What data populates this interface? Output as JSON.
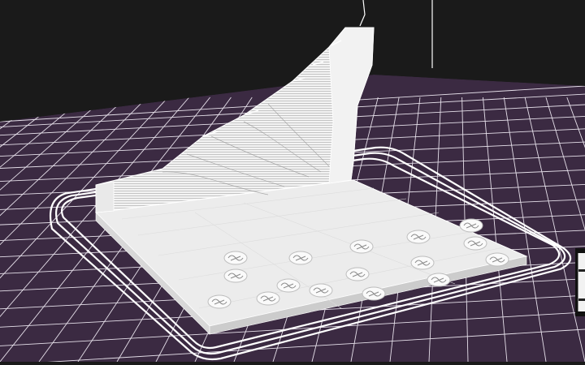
{
  "viewport": {
    "background_color": "#1a1a1a",
    "grid_fill_color": "#3b2a42",
    "grid_line_color": "#e6e0ea",
    "model_color": "#f5f5f5",
    "shading_color": "#bdbdbd",
    "skirt_color": "#ffffff",
    "skirt_loops": 3,
    "label_count": 16
  },
  "widgets": {
    "right_edge_panel": "panel-handle"
  }
}
